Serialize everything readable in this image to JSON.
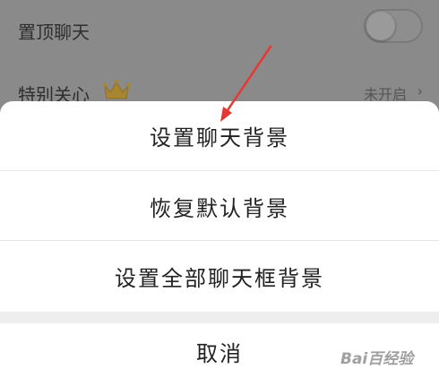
{
  "settings": {
    "pin_chat_label": "置顶聊天",
    "special_care_label": "特别关心",
    "special_care_status": "未开启",
    "chevron": "›"
  },
  "sheet": {
    "items": [
      {
        "label": "设置聊天背景"
      },
      {
        "label": "恢复默认背景"
      },
      {
        "label": "设置全部聊天框背景"
      }
    ],
    "cancel_label": "取消"
  },
  "watermark": {
    "text": "Bai百经验"
  },
  "colors": {
    "overlay": "#8a8a8a",
    "sheet": "#ffffff",
    "arrow": "#e53935",
    "crown": "#c9a23a"
  }
}
